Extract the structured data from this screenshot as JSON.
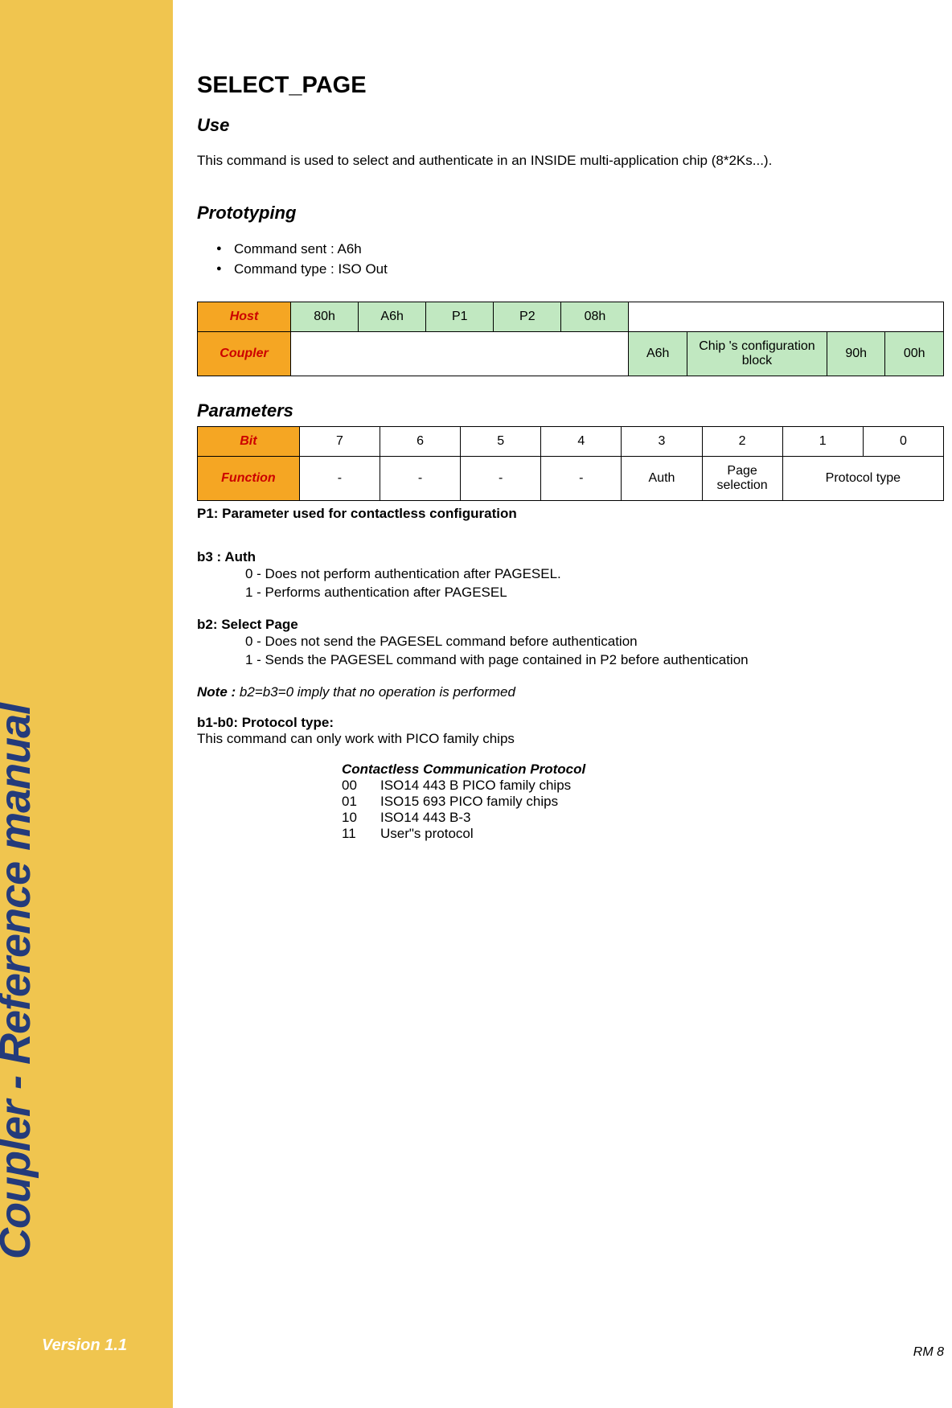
{
  "sidebar": {
    "title": "Coupler - Reference manual",
    "version": "Version 1.1"
  },
  "pageNumber": "RM 8",
  "title": "SELECT_PAGE",
  "use": {
    "heading": "Use",
    "text": "This command is used to select and authenticate in an INSIDE multi-application chip (8*2Ks...)."
  },
  "prototyping": {
    "heading": "Prototyping",
    "bullets": [
      "Command sent : A6h",
      "Command type : ISO Out"
    ],
    "hostLabel": "Host",
    "couplerLabel": "Coupler",
    "hostCells": [
      "80h",
      "A6h",
      "P1",
      "P2",
      "08h"
    ],
    "couplerCells": [
      "A6h",
      "Chip 's configuration block",
      "90h",
      "00h"
    ]
  },
  "parameters": {
    "heading": "Parameters",
    "bitLabel": "Bit",
    "funcLabel": "Function",
    "bits": [
      "7",
      "6",
      "5",
      "4",
      "3",
      "2",
      "1",
      "0"
    ],
    "funcDash": "-",
    "funcAuth": "Auth",
    "funcPageSel": "Page selection",
    "funcProto": "Protocol type",
    "p1Line": "P1: Parameter used for contactless configuration",
    "b3": {
      "title": "b3 : Auth",
      "l0": "0 - Does not perform authentication after PAGESEL.",
      "l1": "1 - Performs authentication after PAGESEL"
    },
    "b2": {
      "title": "b2: Select Page",
      "l0": "0 - Does not send the PAGESEL command before authentication",
      "l1": "1 - Sends the PAGESEL command with page contained in P2 before authentication"
    },
    "note": {
      "label": "Note : ",
      "body": "b2=b3=0 imply that no operation is performed"
    },
    "b1b0": {
      "title": "b1-b0: Protocol type:",
      "sub": "This command can only work with PICO family chips",
      "protoHeading": "Contactless Communication Protocol",
      "rows": [
        {
          "code": "00",
          "desc": "ISO14 443 B PICO family chips"
        },
        {
          "code": "01",
          "desc": "ISO15 693 PICO family chips"
        },
        {
          "code": "10",
          "desc": "ISO14 443 B-3"
        },
        {
          "code": "11",
          "desc": "User\"s protocol"
        }
      ]
    }
  }
}
